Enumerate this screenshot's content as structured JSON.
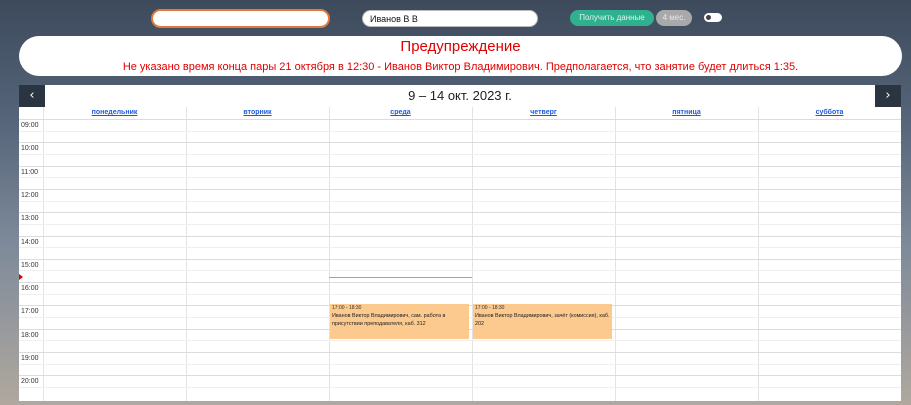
{
  "toolbar": {
    "search_value": "",
    "teacher_value": "Иванов В В",
    "get_data_label": "Получить данные",
    "period_label": "4 мес."
  },
  "warning": {
    "title": "Предупреждение",
    "text": "Не указано время конца пары 21 октября в 12:30 - Иванов Виктор Владимирович. Предполагается, что занятие будет длиться 1:35."
  },
  "calendar": {
    "prev_icon": "‹",
    "next_icon": "›",
    "title": "9 – 14 окт. 2023 г.",
    "days": [
      "понедельник",
      "вторник",
      "среда",
      "четверг",
      "пятница",
      "суббота"
    ],
    "hours": [
      "09:00",
      "10:00",
      "11:00",
      "12:00",
      "13:00",
      "14:00",
      "15:00",
      "16:00",
      "17:00",
      "18:00",
      "19:00",
      "20:00"
    ],
    "events": [
      {
        "day": 2,
        "start": "17:00",
        "end": "18:30",
        "time": "17:00 - 18:30",
        "title": "Иванов Виктор Владимирович, сам. работа в присутствии преподавателя, каб. 312"
      },
      {
        "day": 3,
        "start": "17:00",
        "end": "18:30",
        "time": "17:00 - 18:30",
        "title": "Иванов Виктор Владимирович, зачёт (комиссия), каб. 202"
      }
    ]
  },
  "colors": {
    "accent": "#2fb08e",
    "warning": "#e00000",
    "event": "#fcc98f",
    "link": "#1e5bd8"
  }
}
